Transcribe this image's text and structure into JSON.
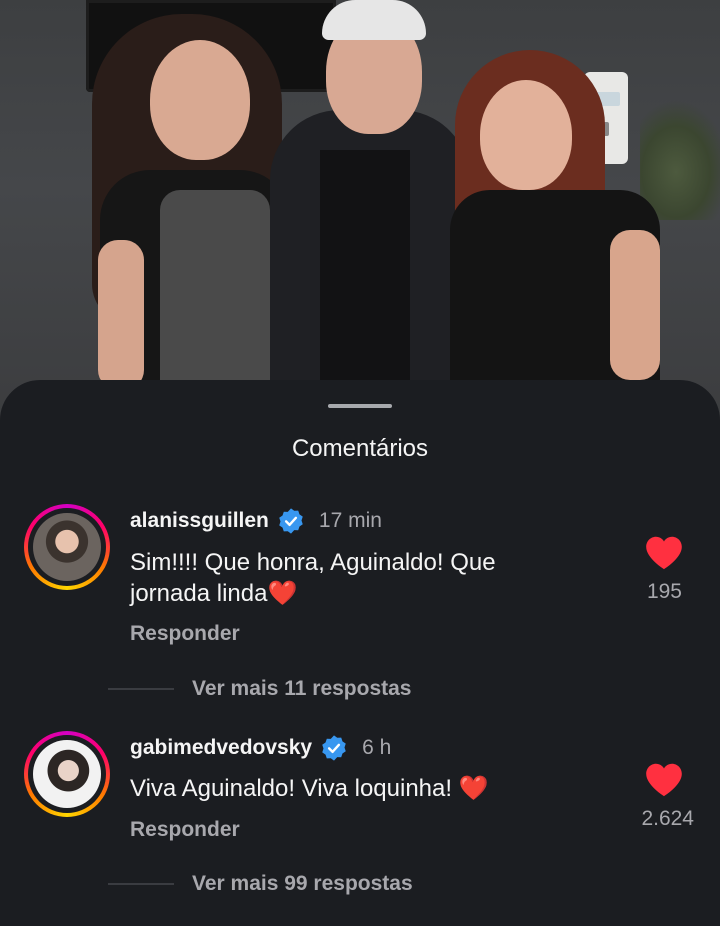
{
  "sheet": {
    "title": "Comentários"
  },
  "comments": [
    {
      "username": "alanissguillen",
      "time": "17 min",
      "text_line1": "Sim!!!! Que honra, Aguinaldo! Que",
      "text_line2": "jornada linda",
      "emoji": "❤️",
      "reply_label": "Responder",
      "likes": "195",
      "more_replies": "Ver mais 11 respostas"
    },
    {
      "username": "gabimedvedovsky",
      "time": "6 h",
      "text_line1": "Viva Aguinaldo! Viva loquinha!",
      "emoji": "❤️",
      "reply_label": "Responder",
      "likes": "2.624",
      "more_replies": "Ver mais 99 respostas"
    }
  ],
  "colors": {
    "background": "#1b1d21",
    "like_red": "#ff3040",
    "verified_blue": "#3897f0",
    "secondary_text": "#a8a8ad"
  },
  "icons": {
    "like": "heart-icon",
    "verified": "verified-badge-icon"
  }
}
